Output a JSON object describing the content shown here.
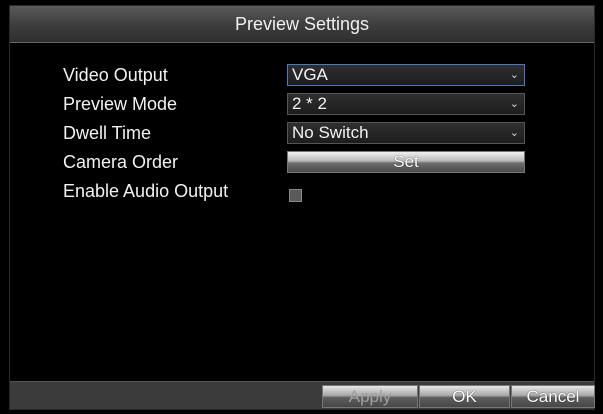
{
  "dialog": {
    "title": "Preview Settings"
  },
  "fields": {
    "video_output": {
      "label": "Video Output",
      "value": "VGA"
    },
    "preview_mode": {
      "label": "Preview Mode",
      "value": "2 * 2"
    },
    "dwell_time": {
      "label": "Dwell Time",
      "value": "No Switch"
    },
    "camera_order": {
      "label": "Camera Order",
      "button_label": "Set"
    },
    "enable_audio_output": {
      "label": "Enable Audio Output",
      "checked": false
    }
  },
  "footer": {
    "apply_label": "Apply",
    "ok_label": "OK",
    "cancel_label": "Cancel"
  },
  "icons": {
    "dropdown": "chevron-down-icon"
  },
  "colors": {
    "focus_border": "#4a78c8",
    "background": "#000000"
  }
}
